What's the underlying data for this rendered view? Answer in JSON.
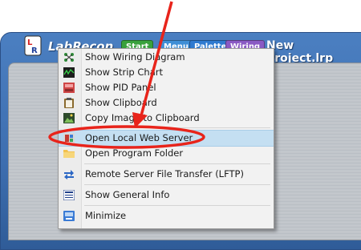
{
  "app": {
    "name": "LabRecon",
    "project_title": "New Project.lrp",
    "tabs": [
      "Start",
      "Menu",
      "Palette",
      "Wiring"
    ]
  },
  "context_menu": {
    "items": [
      {
        "label": "Show Wiring Diagram",
        "icon": "wiring-diagram-icon"
      },
      {
        "label": "Show Strip Chart",
        "icon": "strip-chart-icon"
      },
      {
        "label": "Show PID Panel",
        "icon": "pid-panel-icon"
      },
      {
        "label": "Show Clipboard",
        "icon": "clipboard-icon"
      },
      {
        "label": "Copy Image to Clipboard",
        "icon": "copy-image-icon"
      },
      {
        "label": "Open Local Web Server",
        "icon": "web-server-icon",
        "highlighted": true
      },
      {
        "label": "Open Program Folder",
        "icon": "folder-icon"
      },
      {
        "label": "Remote Server File Transfer (LFTP)",
        "icon": "file-transfer-icon"
      },
      {
        "label": "Show General Info",
        "icon": "info-icon"
      },
      {
        "label": "Minimize",
        "icon": "minimize-icon"
      }
    ]
  },
  "colors": {
    "annotation": "#e8241b",
    "highlight": "#c4dff2",
    "titlebar": "#3d6eb0"
  }
}
